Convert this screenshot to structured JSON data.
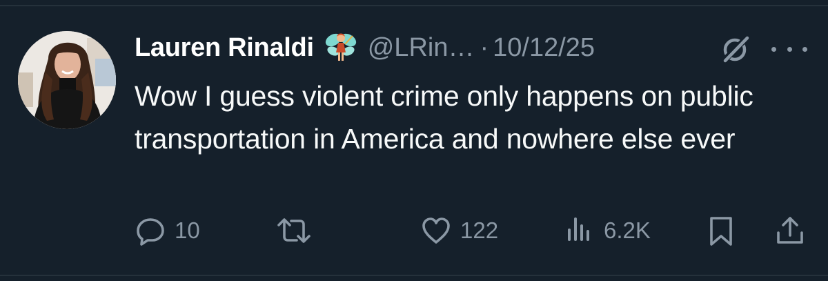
{
  "author": {
    "display_name": "Lauren Rinaldi",
    "handle": "@LRin…",
    "separator": "·",
    "date": "10/12/25",
    "badge_icon": "fairy-emoji-icon",
    "avatar": "avatar"
  },
  "tweet": {
    "text": "Wow I guess violent crime only happens on public transportation in America and nowhere else ever"
  },
  "actions": {
    "reply": {
      "icon": "reply-icon",
      "count": "10"
    },
    "retweet": {
      "icon": "retweet-icon"
    },
    "like": {
      "icon": "heart-icon",
      "count": "122"
    },
    "views": {
      "icon": "views-icon",
      "count": "6.2K"
    },
    "bookmark": {
      "icon": "bookmark-icon"
    },
    "share": {
      "icon": "share-icon"
    }
  },
  "header_icons": {
    "grok": "grok-icon",
    "more": "more-icon"
  },
  "colors": {
    "background": "#15202b",
    "text_primary": "#ffffff",
    "text_secondary": "#8b98a5",
    "divider": "#38444d"
  }
}
